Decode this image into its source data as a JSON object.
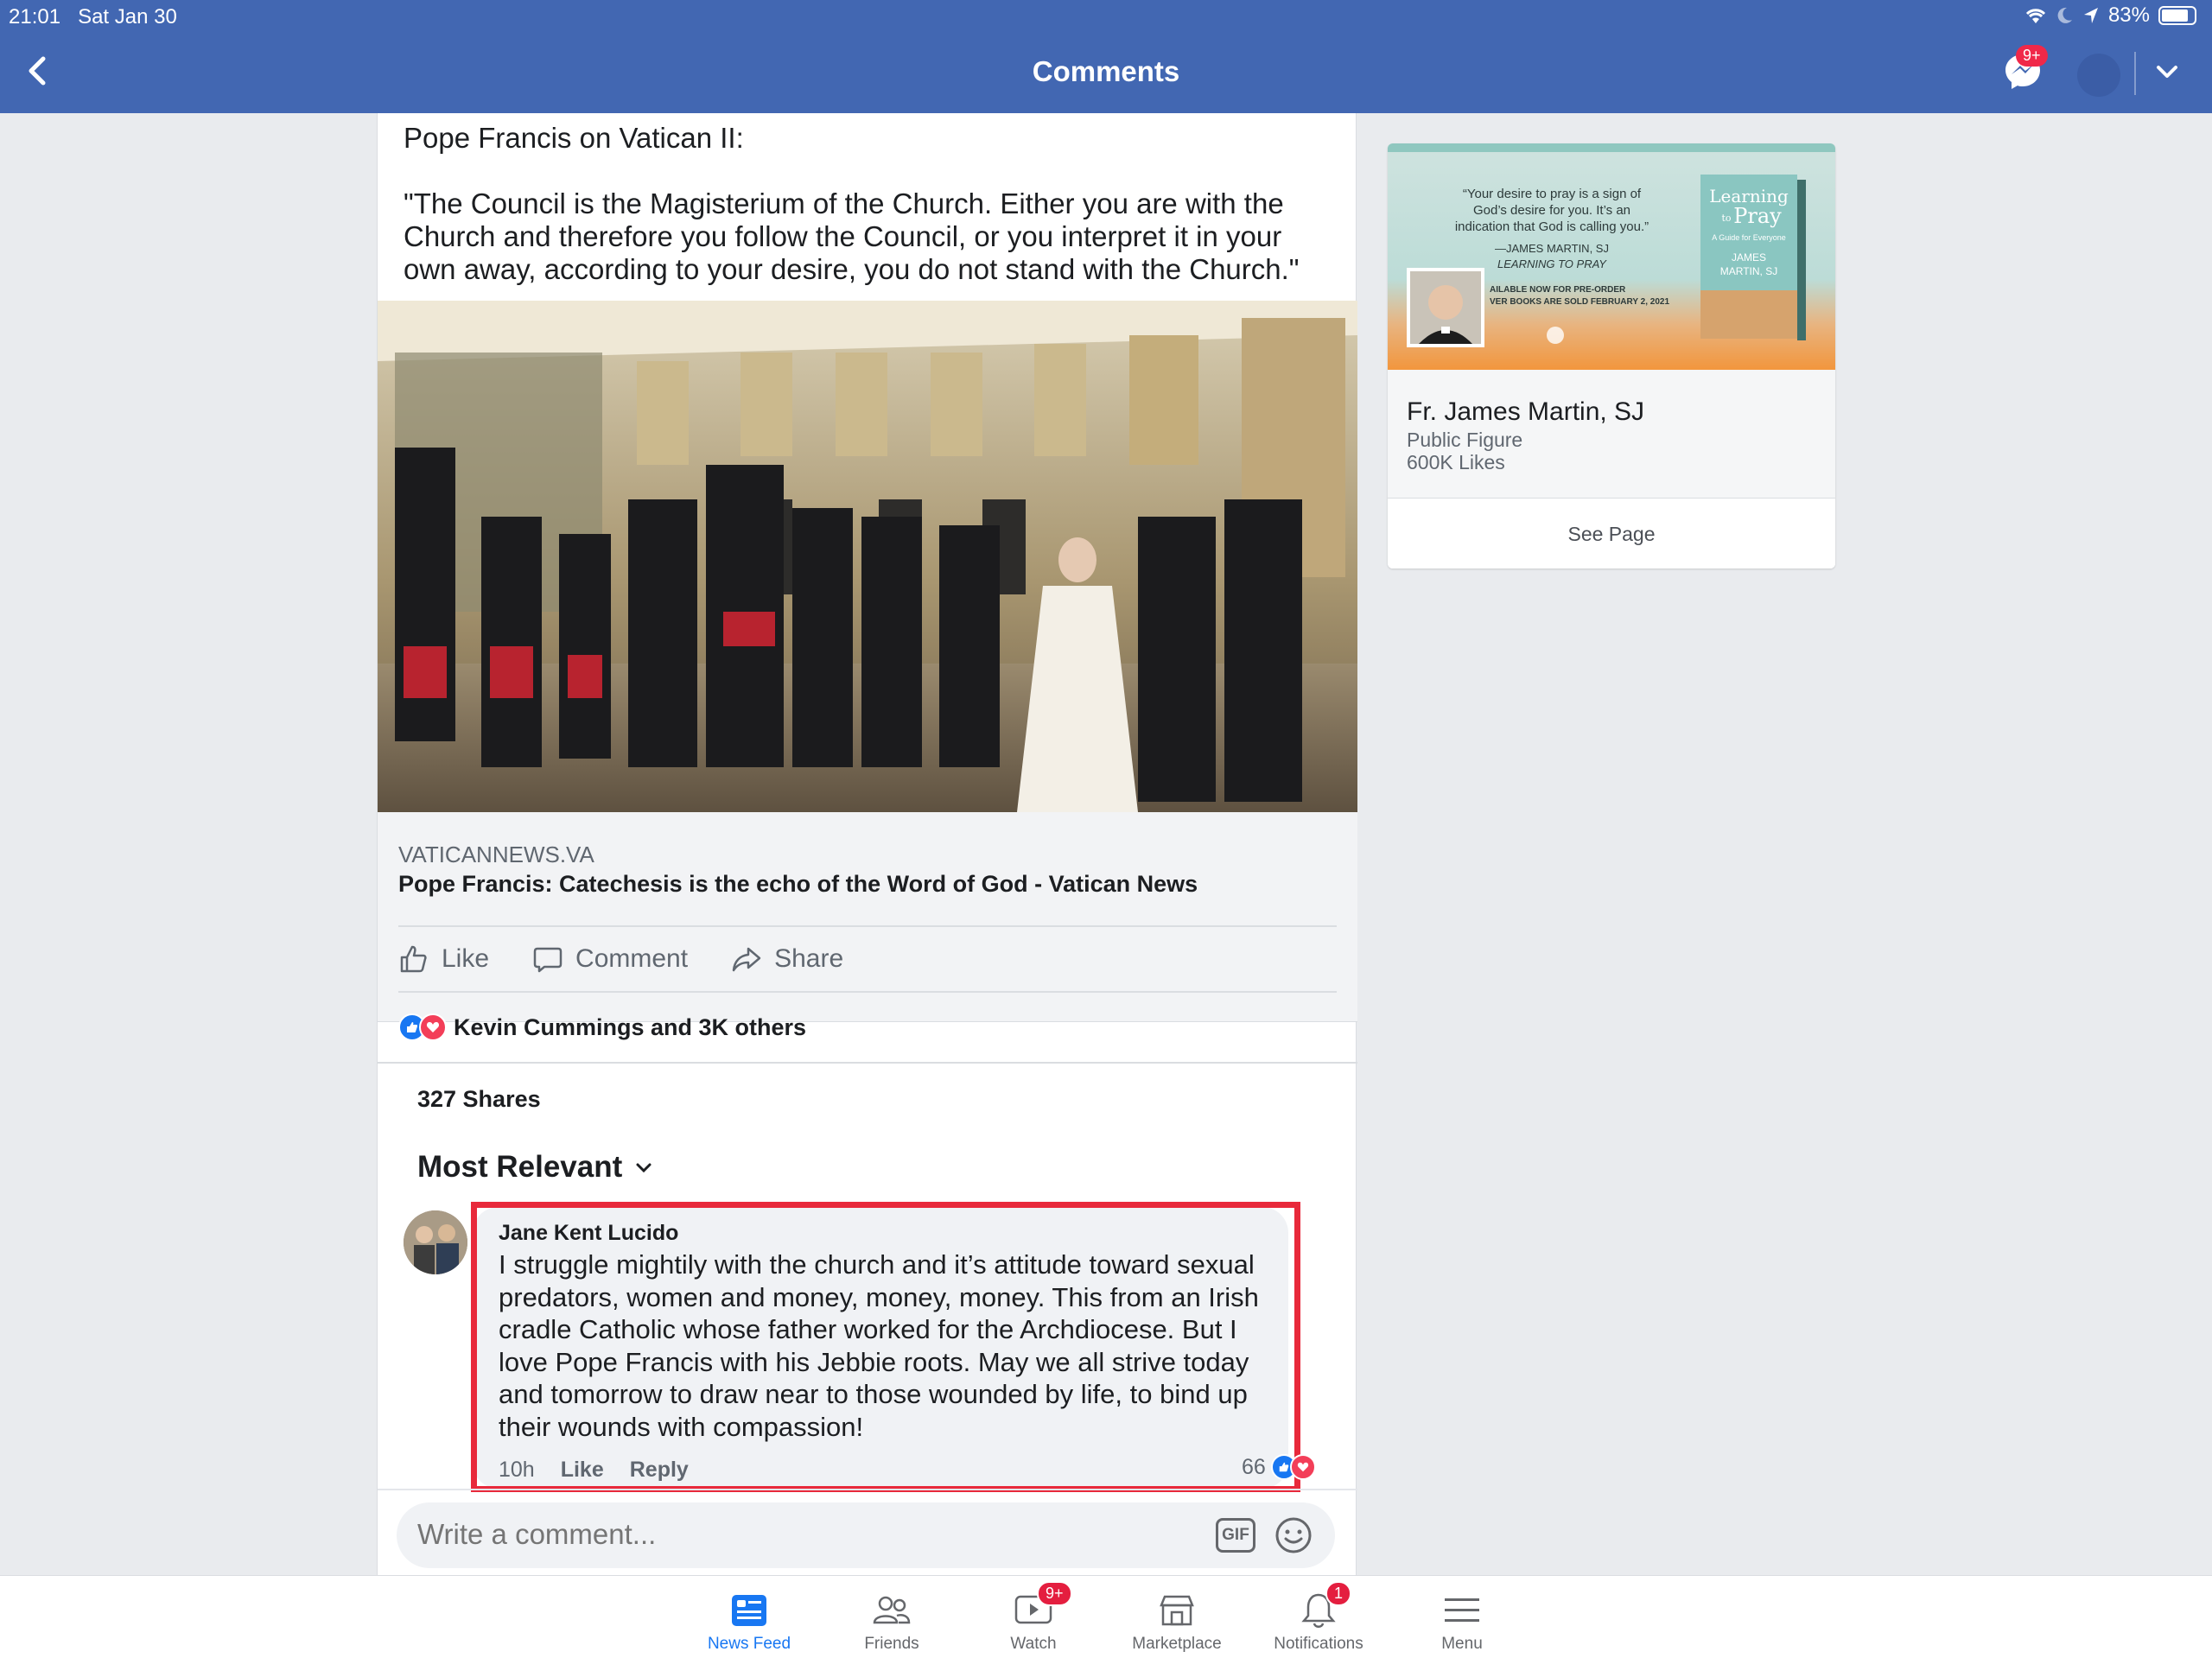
{
  "status": {
    "time": "21:01",
    "date": "Sat Jan 30",
    "battery": "83%",
    "battery_level": 0.83
  },
  "header": {
    "title": "Comments",
    "messenger_badge": "9+"
  },
  "post": {
    "text_intro": "Pope Francis on Vatican II:",
    "text_quote": "\"The Council is the Magisterium of the Church. Either you are with the Church and therefore you follow the Council, or you interpret it in your own away, according to your desire, you do not stand with the Church.\"",
    "link_domain": "VATICANNEWS.VA",
    "link_title": "Pope Francis: Catechesis is the echo of the Word of God - Vatican News",
    "actions": {
      "like": "Like",
      "comment": "Comment",
      "share": "Share"
    },
    "reactions_text": "Kevin Cummings and 3K others",
    "shares": "327 Shares",
    "sort_label": "Most Relevant"
  },
  "comment": {
    "author": "Jane Kent Lucido",
    "text": "I struggle mightily with the church and it’s attitude toward sexual predators, women and money, money, money. This from an Irish cradle Catholic whose father worked for the Archdiocese. But I love Pope Francis with his Jebbie roots.  May we all strive today and tomorrow to draw near to those wounded by life, to bind up their wounds with compassion!",
    "time": "10h",
    "like": "Like",
    "reply": "Reply",
    "reaction_count": "66"
  },
  "composer": {
    "placeholder": "Write a comment...",
    "gif": "GIF"
  },
  "sidebar_card": {
    "quote": "“Your desire to pray is a sign of God’s desire for you. It’s an indication that God is calling you.”",
    "quote_attrib": "—JAMES MARTIN, SJ",
    "quote_book": "LEARNING TO PRAY",
    "preorder_1": "AILABLE NOW FOR PRE-ORDER",
    "preorder_2": "VER BOOKS ARE SOLD FEBRUARY 2, 2021",
    "book_title_1": "Learning",
    "book_title_2": "to",
    "book_title_3": "Pray",
    "book_subtitle": "A Guide for Everyone",
    "book_author_1": "JAMES",
    "book_author_2": "MARTIN, SJ",
    "name": "Fr. James Martin, SJ",
    "type": "Public Figure",
    "likes": "600K Likes",
    "see_page": "See Page"
  },
  "tabbar": {
    "tabs": [
      {
        "label": "News Feed"
      },
      {
        "label": "Friends"
      },
      {
        "label": "Watch",
        "badge": "9+"
      },
      {
        "label": "Marketplace"
      },
      {
        "label": "Notifications",
        "badge": "1"
      },
      {
        "label": "Menu"
      }
    ]
  },
  "colors": {
    "brand": "#4267b2",
    "accent": "#1877f2",
    "highlight": "#e8293b",
    "badge": "#e41e3f"
  }
}
